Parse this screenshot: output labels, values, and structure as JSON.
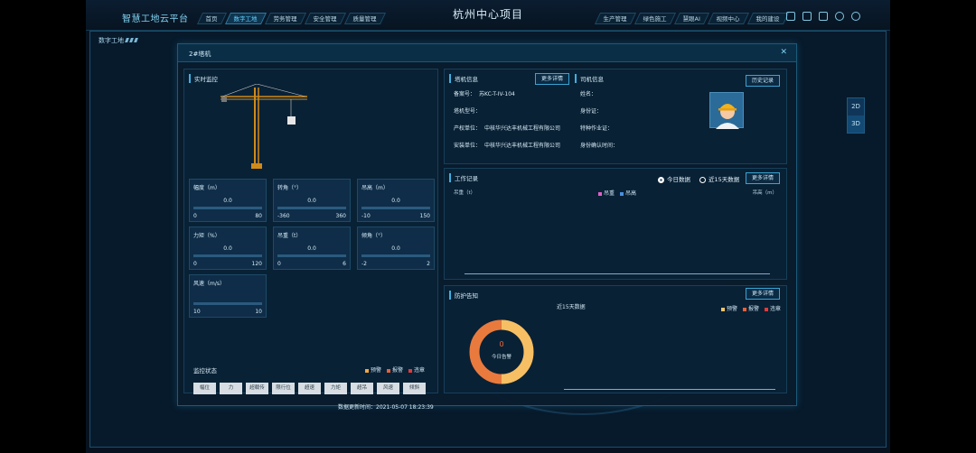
{
  "app": {
    "brand": "智慧工地云平台",
    "project": "杭州中心项目"
  },
  "nav_left": [
    "首页",
    "数字工地",
    "劳务管理",
    "安全管理",
    "质量管理"
  ],
  "nav_right": [
    "生产管理",
    "绿色施工",
    "慧眼AI",
    "视频中心",
    "我的建设"
  ],
  "topbar_icons": [
    "monitor-icon",
    "screen-icon",
    "checklist-icon",
    "gear-icon",
    "power-icon"
  ],
  "frame": {
    "label": "数字工地",
    "toggles": [
      "2D",
      "3D"
    ]
  },
  "modal": {
    "title": "2#塔机",
    "close": "✕",
    "realtime": {
      "title": "实时监控",
      "metrics": [
        {
          "label": "幅度（m）",
          "value": "0.0",
          "min": "0",
          "max": "80",
          "level": 0
        },
        {
          "label": "转角（°）",
          "value": "0.0",
          "min": "-360",
          "max": "360",
          "level": 0
        },
        {
          "label": "吊高（m）",
          "value": "0.0",
          "min": "-10",
          "max": "150",
          "level": 0
        },
        {
          "label": "力矩（%）",
          "value": "0.0",
          "min": "0",
          "max": "120",
          "level": 0
        },
        {
          "label": "吊重（t）",
          "value": "0.0",
          "min": "0",
          "max": "6",
          "level": 0
        },
        {
          "label": "倾角（°）",
          "value": "0.0",
          "min": "-2",
          "max": "2",
          "level": 0
        },
        {
          "label": "风速（m/s）",
          "value": "",
          "min": "10",
          "max": "10",
          "level": 0
        }
      ],
      "status_title": "监控状态",
      "legend": [
        {
          "label": "预警",
          "color": "#f4a640"
        },
        {
          "label": "报警",
          "color": "#e8603a"
        },
        {
          "label": "违章",
          "color": "#e23a3a"
        }
      ],
      "chips": [
        "幅位",
        "力",
        "超载传",
        "限行位",
        "超速",
        "力矩",
        "超吊",
        "风速",
        "倾斜"
      ],
      "updated_label": "数据更新时间：",
      "updated_value": "2021-05-07 18:23:39"
    },
    "crane_info": {
      "title": "塔机信息",
      "btn": "更多详情",
      "fields": [
        {
          "k": "备案号：",
          "v": "苏KC-T-IV-104"
        },
        {
          "k": "塔机型号：",
          "v": ""
        },
        {
          "k": "产权单位：",
          "v": "中核华兴达丰机械工程有限公司"
        },
        {
          "k": "安装单位：",
          "v": "中核华兴达丰机械工程有限公司"
        }
      ]
    },
    "driver_info": {
      "title": "司机信息",
      "btn": "历史记录",
      "fields": [
        {
          "k": "姓名："
        },
        {
          "k": "身份证："
        },
        {
          "k": "特种作业证："
        },
        {
          "k": "身份确认时间："
        }
      ]
    },
    "work_record": {
      "title": "工作记录",
      "btn": "更多详情",
      "radio_today": "今日数据",
      "radio_15": "近15天数据",
      "left_axis": "吊重（t）",
      "right_axis": "吊高（m）",
      "legend": [
        {
          "label": "吊重",
          "color": "#e060c8"
        },
        {
          "label": "吊高",
          "color": "#4a8fe0"
        }
      ]
    },
    "warning": {
      "title": "防护告知",
      "btn": "更多详情",
      "subtitle": "近15天数据",
      "center_value": "0",
      "center_label": "今日告警",
      "legend": [
        {
          "label": "预警",
          "color": "#f4c46a"
        },
        {
          "label": "报警",
          "color": "#e8603a"
        },
        {
          "label": "违章",
          "color": "#e23a3a"
        }
      ]
    }
  }
}
